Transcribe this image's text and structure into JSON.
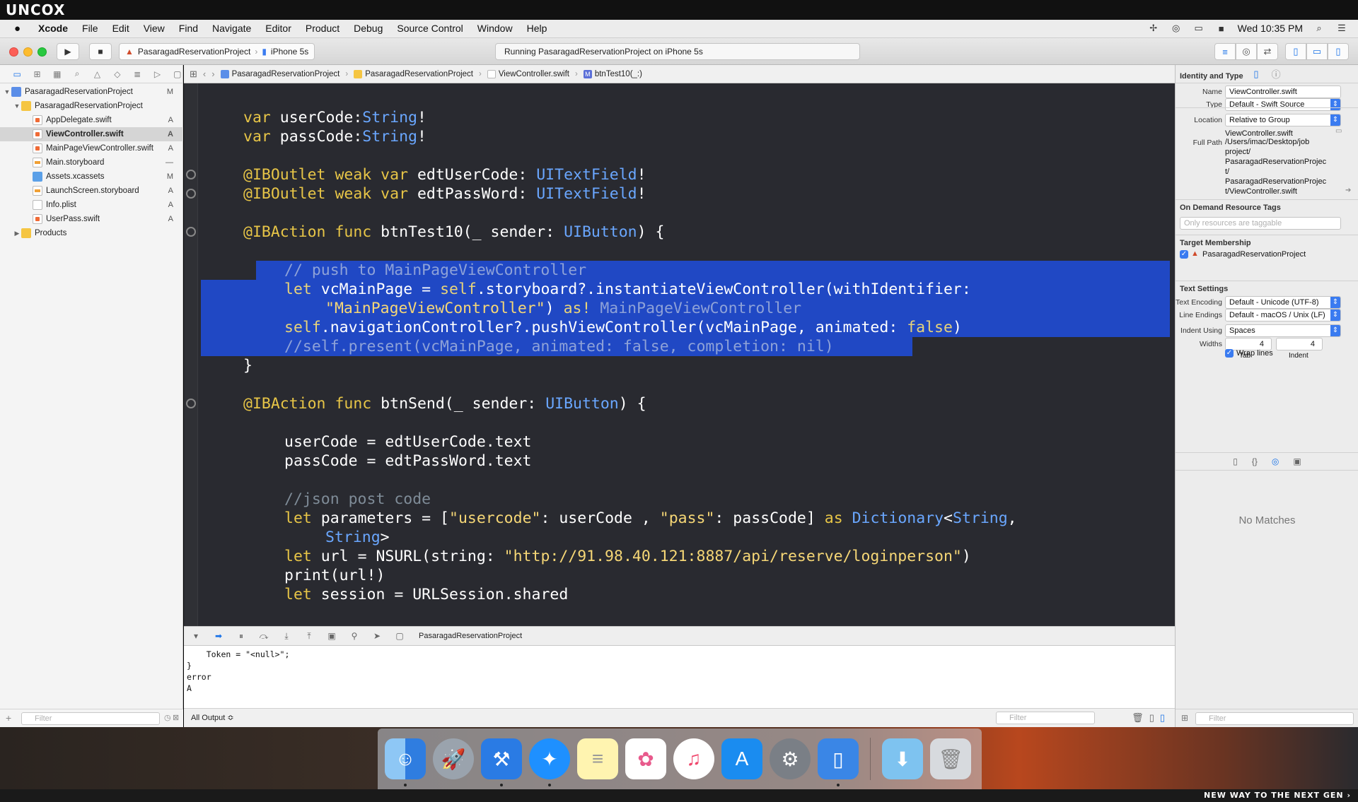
{
  "brand": {
    "logo": "UNCOX",
    "tagline": "NEW WAY TO THE NEXT GEN ›"
  },
  "menubar": {
    "apple": "",
    "items": [
      "Xcode",
      "File",
      "Edit",
      "View",
      "Find",
      "Navigate",
      "Editor",
      "Product",
      "Debug",
      "Source Control",
      "Window",
      "Help"
    ],
    "clock": "Wed 10:35 PM"
  },
  "toolbar": {
    "scheme": "PasaragadReservationProject",
    "device": "iPhone 5s",
    "activity": "Running PasaragadReservationProject on iPhone 5s"
  },
  "navigator": {
    "items": [
      {
        "label": "PasaragadReservationProject",
        "badge": "M"
      },
      {
        "label": "PasaragadReservationProject",
        "badge": ""
      },
      {
        "label": "AppDelegate.swift",
        "badge": "A"
      },
      {
        "label": "ViewController.swift",
        "badge": "A"
      },
      {
        "label": "MainPageViewController.swift",
        "badge": "A"
      },
      {
        "label": "Main.storyboard",
        "badge": "—"
      },
      {
        "label": "Assets.xcassets",
        "badge": "M"
      },
      {
        "label": "LaunchScreen.storyboard",
        "badge": "A"
      },
      {
        "label": "Info.plist",
        "badge": "A"
      },
      {
        "label": "UserPass.swift",
        "badge": "A"
      },
      {
        "label": "Products",
        "badge": ""
      }
    ],
    "filter_placeholder": "Filter"
  },
  "jumpbar": {
    "crumbs": [
      "PasaragadReservationProject",
      "PasaragadReservationProject",
      "ViewController.swift",
      "btnTest10(_:)"
    ],
    "method_badge": "M"
  },
  "code": {
    "l1a": "var",
    "l1b": " userCode:",
    "l1c": "String",
    "l1d": "!",
    "l2a": "var",
    "l2b": " passCode:",
    "l2c": "String",
    "l2d": "!",
    "l3a": "@IBOutlet",
    "l3b": " weak",
    "l3c": " var",
    "l3d": " edtUserCode: ",
    "l3e": "UITextField",
    "l3f": "!",
    "l4a": "@IBOutlet",
    "l4b": " weak",
    "l4c": " var",
    "l4d": " edtPassWord: ",
    "l4e": "UITextField",
    "l4f": "!",
    "l5a": "@IBAction",
    "l5b": " func",
    "l5c": " btnTest10(_ sender: ",
    "l5d": "UIButton",
    "l5e": ") {",
    "l6": "// push to MainPageViewController",
    "l7a": "let",
    "l7b": " vcMainPage = ",
    "l7c": "self",
    "l7d": ".storyboard?.instantiateViewController(withIdentifier:",
    "l8a": "\"MainPageViewController\"",
    "l8b": ") ",
    "l8c": "as!",
    "l8d": " MainPageViewController",
    "l9a": "self",
    "l9b": ".navigationController?.pushViewController(vcMainPage, animated: ",
    "l9c": "false",
    "l9d": ")",
    "l10": "//self.present(vcMainPage, animated: false, completion: nil)",
    "l11": "}",
    "l12a": "@IBAction",
    "l12b": " func",
    "l12c": " btnSend(_ sender: ",
    "l12d": "UIButton",
    "l12e": ") {",
    "l13": "userCode = edtUserCode.text",
    "l14": "passCode = edtPassWord.text",
    "l15": "//json post code",
    "l16a": "let",
    "l16b": " parameters = [",
    "l16c": "\"usercode\"",
    "l16d": ": userCode , ",
    "l16e": "\"pass\"",
    "l16f": ": passCode] ",
    "l16g": "as",
    "l16h": " Dictionary",
    "l16i": "<",
    "l16j": "String",
    "l16k": ",",
    "l17a": "String",
    "l17b": ">",
    "l18a": "let",
    "l18b": " url = NSURL(string: ",
    "l18c": "\"http://91.98.40.121:8887/api/reserve/loginperson\"",
    "l18d": ")",
    "l19": "print(url!)",
    "l20a": "let",
    "l20b": " session = URLSession.shared"
  },
  "debug": {
    "target": "PasaragadReservationProject"
  },
  "console": {
    "text": "    Token = \"<null>\";\n}\nerror\nA",
    "output_select": "All Output ≎",
    "filter_placeholder": "Filter"
  },
  "inspector": {
    "identity_title": "Identity and Type",
    "name_label": "Name",
    "name_value": "ViewController.swift",
    "type_label": "Type",
    "type_value": "Default - Swift Source",
    "location_label": "Location",
    "location_value": "Relative to Group",
    "location_file": "ViewController.swift",
    "fullpath_label": "Full Path",
    "fullpath_lines": [
      "/Users/imac/Desktop/job",
      "project/",
      "PasaragadReservationProjec",
      "t/",
      "PasaragadReservationProjec",
      "t/ViewController.swift"
    ],
    "odr_title": "On Demand Resource Tags",
    "odr_placeholder": "Only resources are taggable",
    "target_title": "Target Membership",
    "target_item": "PasaragadReservationProject",
    "text_title": "Text Settings",
    "encoding_label": "Text Encoding",
    "encoding_value": "Default - Unicode (UTF-8)",
    "endings_label": "Line Endings",
    "endings_value": "Default - macOS / Unix (LF)",
    "indent_label": "Indent Using",
    "indent_value": "Spaces",
    "widths_label": "Widths",
    "tab_value": "4",
    "indent_width_value": "4",
    "tab_caption": "Tab",
    "indent_caption": "Indent",
    "wrap_label": "Wrap lines",
    "no_matches": "No Matches",
    "filter_placeholder": "Filter"
  },
  "colors": {
    "editor_bg": "#292a30",
    "selection": "#2048c4",
    "accent": "#1a73e8"
  }
}
